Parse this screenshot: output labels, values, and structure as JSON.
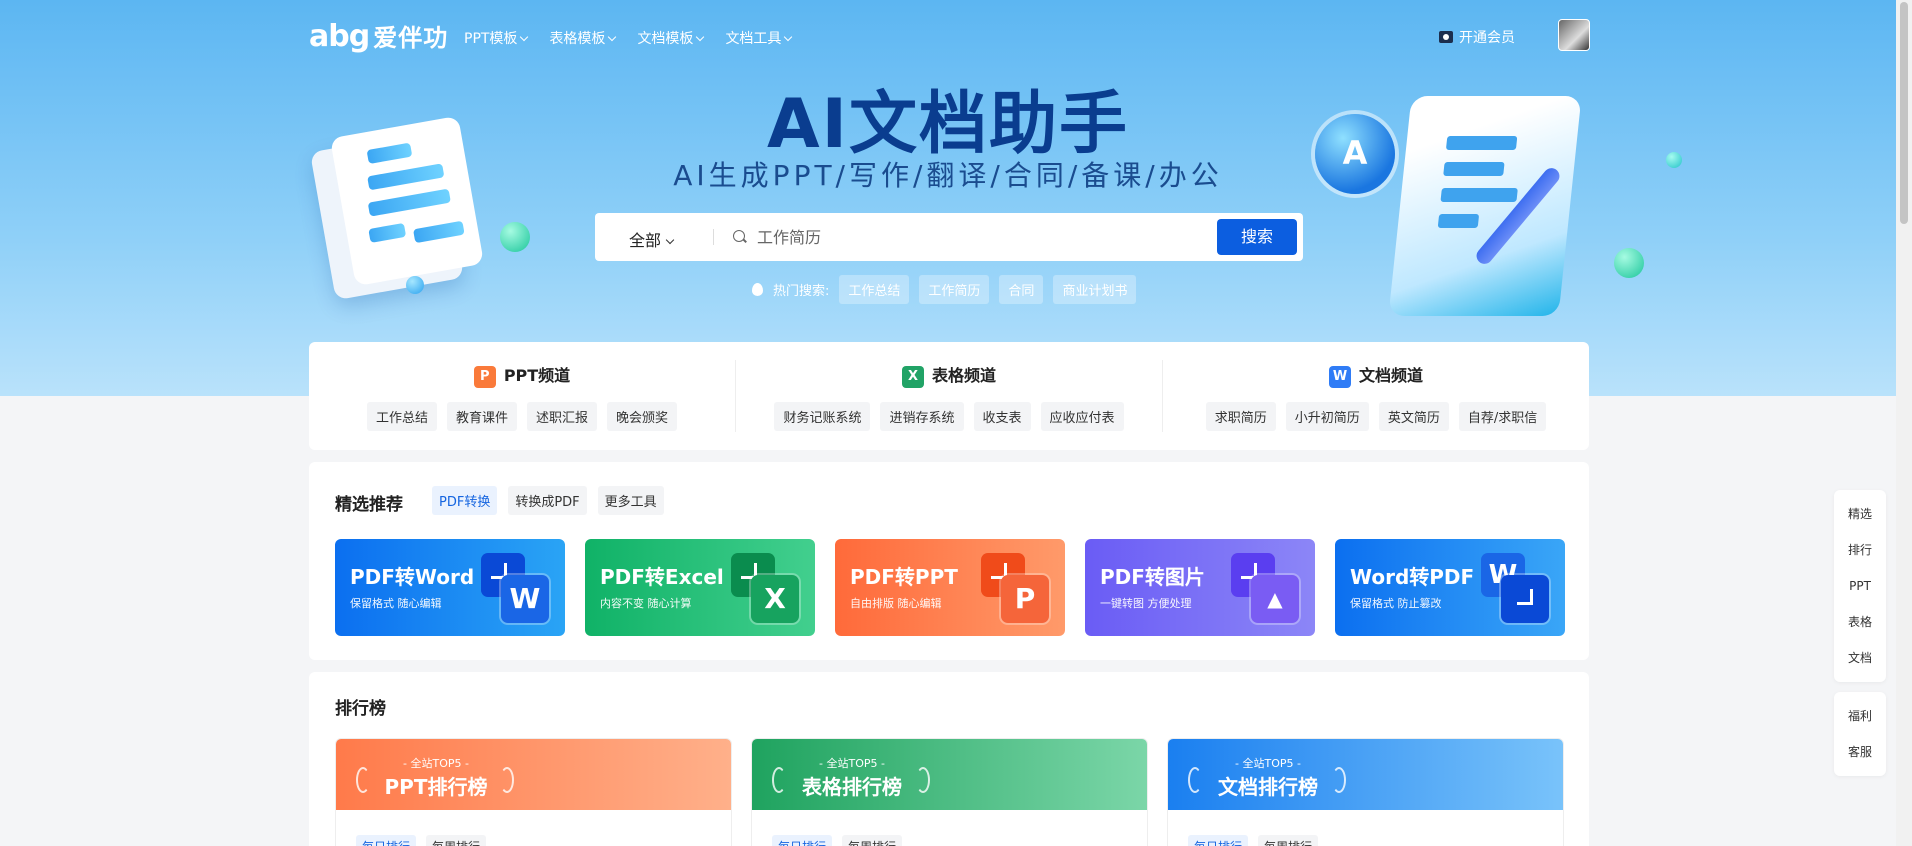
{
  "nav": {
    "logo_en": "abg",
    "logo_cn": "爱伴功",
    "menu": [
      {
        "label": "PPT模板"
      },
      {
        "label": "表格模板"
      },
      {
        "label": "文档模板"
      },
      {
        "label": "文档工具"
      }
    ],
    "vip_label": "开通会员"
  },
  "hero": {
    "title": "AI文档助手",
    "subtitle": "AI生成PPT/写作/翻译/合同/备课/办公",
    "search": {
      "scope": "全部",
      "placeholder": "工作简历",
      "button": "搜索"
    },
    "hot_label": "热门搜索:",
    "hot_tags": [
      "工作总结",
      "工作简历",
      "合同",
      "商业计划书"
    ],
    "logo_badge": "A"
  },
  "channels": [
    {
      "icon": "P",
      "title": "PPT频道",
      "color": "#fa7a3a",
      "tags": [
        "工作总结",
        "教育课件",
        "述职汇报",
        "晚会颁奖"
      ]
    },
    {
      "icon": "X",
      "title": "表格频道",
      "color": "#21a366",
      "tags": [
        "财务记账系统",
        "进销存系统",
        "收支表",
        "应收应付表"
      ]
    },
    {
      "icon": "W",
      "title": "文档频道",
      "color": "#2f7cf6",
      "tags": [
        "求职简历",
        "小升初简历",
        "英文简历",
        "自荐/求职信"
      ]
    }
  ],
  "featured": {
    "title": "精选推荐",
    "tabs": [
      "PDF转换",
      "转换成PDF",
      "更多工具"
    ],
    "cards": [
      {
        "title": "PDF转Word",
        "sub": "保留格式 随心编辑",
        "letter": "W",
        "bg": "linear-gradient(90deg,#0b6ff0,#2aa4f5)",
        "tile1": "#0a49d6",
        "tile2": "#1a66e6"
      },
      {
        "title": "PDF转Excel",
        "sub": "内容不变 随心计算",
        "letter": "X",
        "bg": "linear-gradient(90deg,#10b267,#42cf8e)",
        "tile1": "#0a8c4e",
        "tile2": "#17a35f"
      },
      {
        "title": "PDF转PPT",
        "sub": "自由排版 随心编辑",
        "letter": "P",
        "bg": "linear-gradient(90deg,#ff6a3a,#ff9a6a)",
        "tile1": "#f04b1a",
        "tile2": "#f5653a"
      },
      {
        "title": "PDF转图片",
        "sub": "一键转图 方便处理",
        "letter": "▲",
        "bg": "linear-gradient(90deg,#6a5cf5,#8c86f7)",
        "tile1": "#5a3ef0",
        "tile2": "#7a5cf3"
      },
      {
        "title": "Word转PDF",
        "sub": "保留格式 防止篡改",
        "letter": "W",
        "bg": "linear-gradient(90deg,#0b6ff0,#3aa6f7)",
        "tile1": "#1a66e6",
        "tile2": "#0a49d6"
      }
    ]
  },
  "ranking": {
    "title": "排行榜",
    "cards": [
      {
        "top5": "- 全站TOP5 -",
        "title": "PPT排行榜",
        "bg": "linear-gradient(90deg,#ff7a4a,#ffb08a)",
        "tabs": [
          "每日排行",
          "每周排行"
        ]
      },
      {
        "top5": "- 全站TOP5 -",
        "title": "表格排行榜",
        "bg": "linear-gradient(90deg,#1fa35f,#7bd6a8)",
        "tabs": [
          "每日排行",
          "每周排行"
        ]
      },
      {
        "top5": "- 全站TOP5 -",
        "title": "文档排行榜",
        "bg": "linear-gradient(90deg,#1a7ff0,#79c3fa)",
        "tabs": [
          "每日排行",
          "每周排行"
        ]
      }
    ]
  },
  "side": {
    "group1": [
      "精选",
      "排行",
      "PPT",
      "表格",
      "文档"
    ],
    "group2": [
      "福利",
      "客服"
    ]
  }
}
